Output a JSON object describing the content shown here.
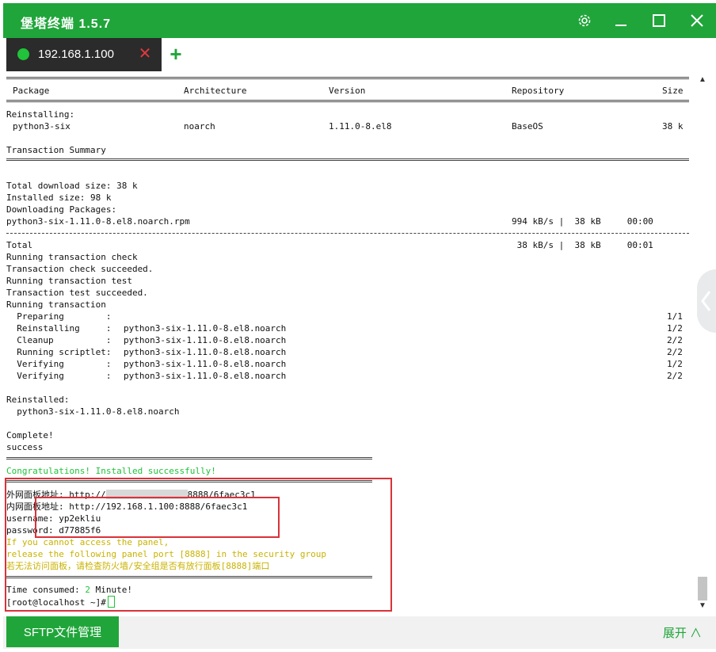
{
  "app": {
    "title": "堡塔终端 1.5.7",
    "accent": "#20a53a"
  },
  "titlebar": {
    "icons": [
      "settings-icon",
      "minimize-icon",
      "maximize-icon",
      "close-icon"
    ]
  },
  "tab": {
    "label": "192.168.1.100",
    "status_color": "#20c33a",
    "close_symbol": "✕",
    "add_symbol": "+"
  },
  "terminal": {
    "table_header": [
      "Package",
      "Architecture",
      "Version",
      "Repository",
      "Size"
    ],
    "reinstalling_label": "Reinstalling:",
    "package_row": [
      "python3-six",
      "noarch",
      "1.11.0-8.el8",
      "BaseOS",
      "38 k"
    ],
    "transaction_summary": "Transaction Summary",
    "total_download": "Total download size: 38 k",
    "installed_size": "Installed size: 98 k",
    "downloading": "Downloading Packages:",
    "download_row": [
      "python3-six-1.11.0-8.el8.noarch.rpm",
      "994 kB/s |  38 kB     00:00"
    ],
    "total_row": [
      "Total",
      " 38 kB/s |  38 kB     00:01"
    ],
    "run_lines": [
      "Running transaction check",
      "Transaction check succeeded.",
      "Running transaction test",
      "Transaction test succeeded.",
      "Running transaction"
    ],
    "steps": [
      {
        "label": "  Preparing        :",
        "pkg": "",
        "count": "1/1"
      },
      {
        "label": "  Reinstalling     :",
        "pkg": "python3-six-1.11.0-8.el8.noarch",
        "count": "1/2"
      },
      {
        "label": "  Cleanup          :",
        "pkg": "python3-six-1.11.0-8.el8.noarch",
        "count": "2/2"
      },
      {
        "label": "  Running scriptlet:",
        "pkg": "python3-six-1.11.0-8.el8.noarch",
        "count": "2/2"
      },
      {
        "label": "  Verifying        :",
        "pkg": "python3-six-1.11.0-8.el8.noarch",
        "count": "1/2"
      },
      {
        "label": "  Verifying        :",
        "pkg": "python3-six-1.11.0-8.el8.noarch",
        "count": "2/2"
      }
    ],
    "reinstalled": "Reinstalled:",
    "reinstalled_pkg": "  python3-six-1.11.0-8.el8.noarch",
    "complete": "Complete!",
    "success": "success",
    "congrats": "Congratulations! Installed successfully!",
    "external_prefix": "外网面板地址: http://",
    "external_suffix": "8888/6faec3c1",
    "internal_url": "内网面板地址: http://192.168.1.100:8888/6faec3c1",
    "username": "username: yp2ekliu",
    "password": "password: d77885f6",
    "warn1": "If you cannot access the panel,",
    "warn2": "release the following panel port [8888] in the security group",
    "warn3": "若无法访问面板，请检查防火墙/安全组是否有放行面板[8888]端口",
    "time_prefix": "Time consumed: ",
    "time_value": "2",
    "time_suffix": " Minute!",
    "prompt": "[root@localhost ~]#"
  },
  "bottom": {
    "sftp_label": "SFTP文件管理",
    "expand_label": "展开 ∧"
  }
}
